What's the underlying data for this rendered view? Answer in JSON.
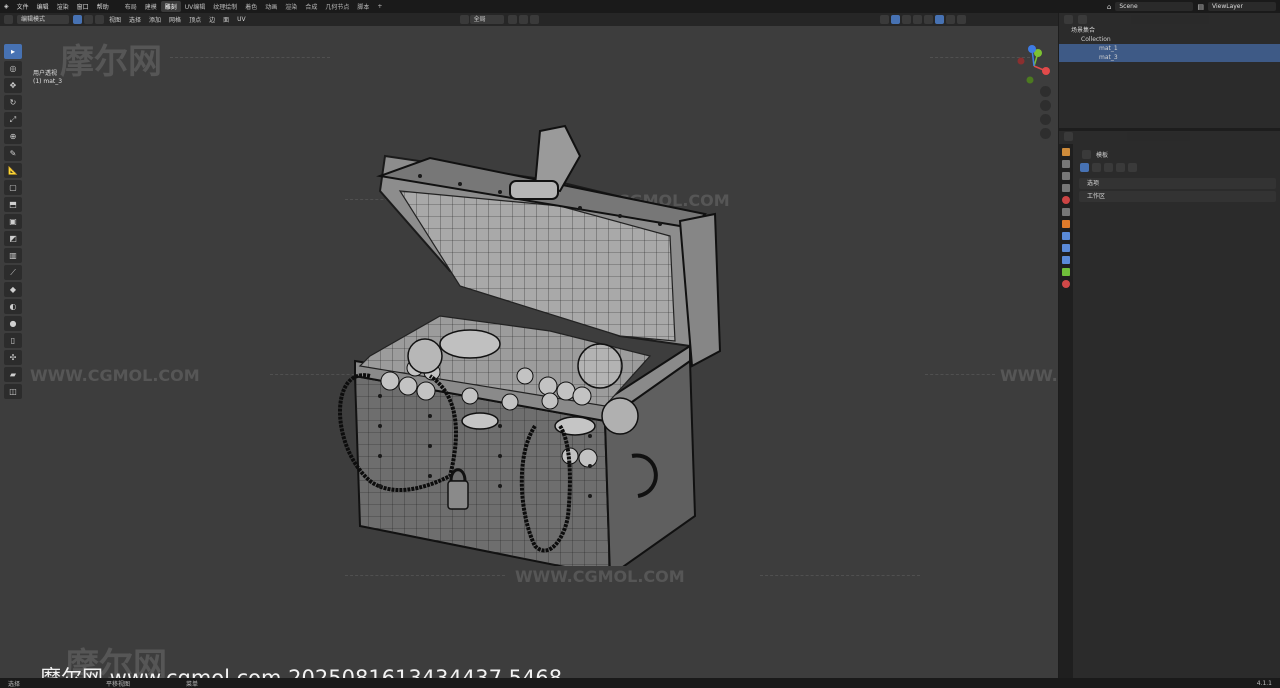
{
  "topbar": {
    "menus": [
      "文件",
      "编辑",
      "渲染",
      "窗口",
      "帮助"
    ],
    "workspaces": [
      "布局",
      "建模",
      "雕刻",
      "UV编辑",
      "纹理绘制",
      "着色",
      "动画",
      "渲染",
      "合成",
      "几何节点",
      "脚本"
    ],
    "active_workspace_index": 2,
    "add_tab": "+",
    "scene_name": "Scene",
    "view_layer": "ViewLayer"
  },
  "viewport_header": {
    "mode": "编辑模式",
    "menus": [
      "视图",
      "选择",
      "添加",
      "网格",
      "顶点",
      "边",
      "面",
      "UV"
    ],
    "transform_orientation": "全局",
    "options_label": "选项"
  },
  "viewport": {
    "view_name": "用户透视",
    "object_name": "(1) mat_3",
    "watermark_site": "WWW.CGMOL.COM",
    "watermark_logo": "摩尔网",
    "caption": "摩尔网 www.cgmol.com 2025081613434437 5468"
  },
  "toolbar": {
    "tools": [
      "select-box",
      "cursor",
      "move",
      "rotate",
      "scale",
      "transform",
      "annotate",
      "measure",
      "add-cube",
      "extrude",
      "inset",
      "bevel",
      "loop-cut",
      "knife",
      "poly-build",
      "spin",
      "smooth",
      "edge-slide",
      "shrink-fatten",
      "shear",
      "rip"
    ]
  },
  "outliner": {
    "search_placeholder": "",
    "scene_collection": "场景集合",
    "collection": "Collection",
    "items": [
      "mat_1",
      "mat_3"
    ]
  },
  "properties": {
    "tool_header": "模板",
    "sections": [
      "选项",
      "工作区"
    ]
  },
  "statusbar": {
    "left": "选择",
    "mid": "平移视图",
    "mid2": "菜单",
    "version": "4.1.1"
  },
  "colors": {
    "accent": "#4772b3",
    "viewport_bg": "#3d3d3d",
    "panel_bg": "#2b2b2b",
    "axis_x": "#e14a4a",
    "axis_y": "#7cc232",
    "axis_z": "#3e7be3"
  }
}
